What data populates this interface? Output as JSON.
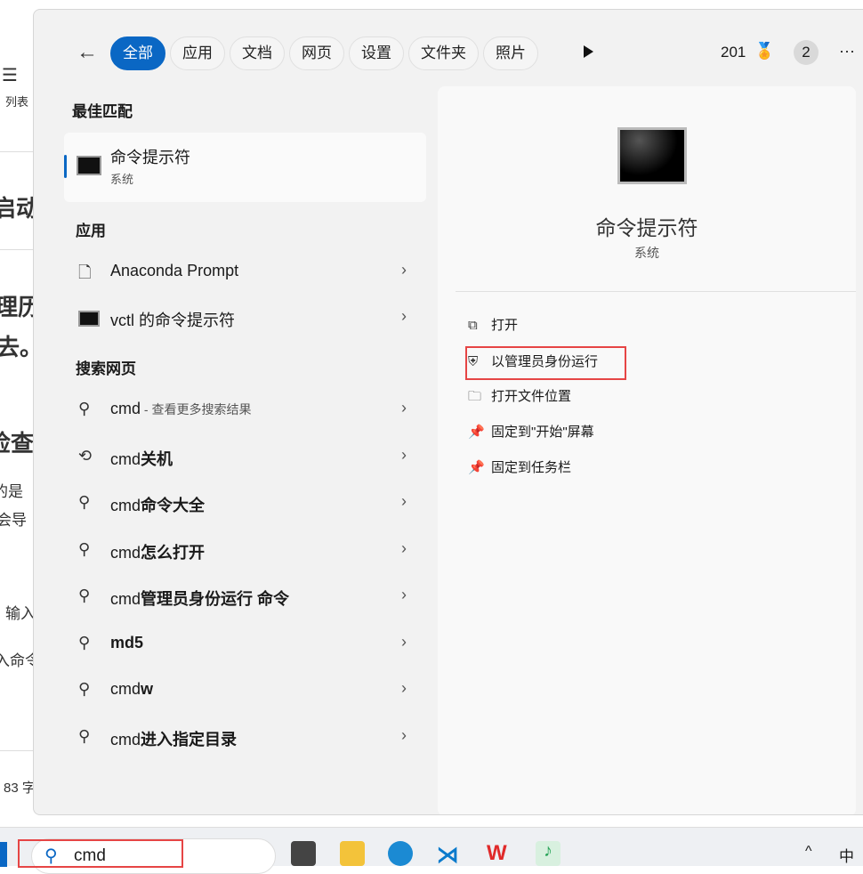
{
  "background": {
    "fragments": [
      "列表",
      "启动",
      "理历",
      "去。",
      "检查",
      "的是",
      "会导",
      "输入",
      "入命令",
      "83 字"
    ]
  },
  "header": {
    "tabs": [
      "全部",
      "应用",
      "文档",
      "网页",
      "设置",
      "文件夹",
      "照片"
    ],
    "points": "201",
    "badge": "2"
  },
  "best_match": {
    "heading": "最佳匹配",
    "name": "命令提示符",
    "subtitle": "系统"
  },
  "apps": {
    "heading": "应用",
    "items": [
      "Anaconda Prompt",
      "vctl 的命令提示符"
    ]
  },
  "web": {
    "heading": "搜索网页",
    "items": [
      {
        "plain": "cmd",
        "bold": "",
        "suffix": " - 查看更多搜索结果",
        "icon": "search-icon"
      },
      {
        "plain": "cmd",
        "bold": "关机",
        "suffix": "",
        "icon": "history-icon"
      },
      {
        "plain": "cmd",
        "bold": "命令大全",
        "suffix": "",
        "icon": "search-icon"
      },
      {
        "plain": "cmd",
        "bold": "怎么打开",
        "suffix": "",
        "icon": "search-icon"
      },
      {
        "plain": "cmd",
        "bold": "管理员身份运行 命令",
        "suffix": "",
        "icon": "search-icon"
      },
      {
        "plain": "",
        "bold": "md5",
        "suffix": "",
        "icon": "search-icon"
      },
      {
        "plain": "cmd",
        "bold": "w",
        "suffix": "",
        "icon": "search-icon"
      },
      {
        "plain": "cmd",
        "bold": "进入指定目录",
        "suffix": "",
        "icon": "search-icon"
      }
    ]
  },
  "detail": {
    "name": "命令提示符",
    "subtitle": "系统",
    "actions": [
      "打开",
      "以管理员身份运行",
      "打开文件位置",
      "固定到\"开始\"屏幕",
      "固定到任务栏"
    ]
  },
  "taskbar": {
    "search_value": "cmd",
    "ime": "中"
  },
  "colors": {
    "accent": "#0a67c4",
    "highlight": "#e64545"
  }
}
